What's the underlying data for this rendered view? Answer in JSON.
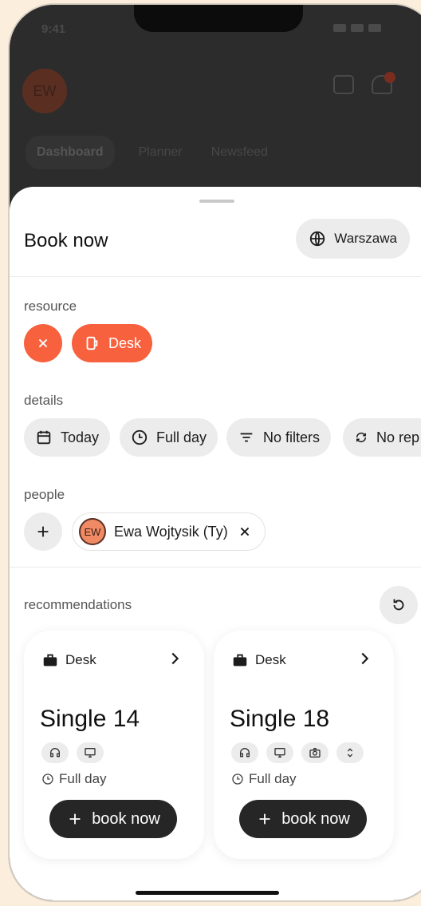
{
  "status": {
    "time": "9:41"
  },
  "background": {
    "avatar_initials": "EW",
    "tabs": [
      "Dashboard",
      "Planner",
      "Newsfeed"
    ]
  },
  "sheet": {
    "title": "Book now",
    "location": "Warszawa",
    "sections": {
      "resource": "resource",
      "details": "details",
      "people": "people",
      "recommendations": "recommendations"
    },
    "resource_chip": "Desk",
    "detail_chips": [
      "Today",
      "Full day",
      "No filters",
      "No rep"
    ],
    "person": {
      "initials": "EW",
      "name": "Ewa Wojtysik (Ty)"
    }
  },
  "recommendations": [
    {
      "type": "Desk",
      "name": "Single 14",
      "duration": "Full day",
      "book_label": "book now",
      "amenities": [
        "headphones-icon",
        "monitor-icon"
      ]
    },
    {
      "type": "Desk",
      "name": "Single 18",
      "duration": "Full day",
      "book_label": "book now",
      "amenities": [
        "headphones-icon",
        "monitor-icon",
        "camera-icon",
        "expand-icon"
      ]
    }
  ],
  "colors": {
    "accent": "#f7613e",
    "dark_button": "#262626",
    "chip_bg": "#ececec",
    "page_bg": "#fbeedd"
  }
}
